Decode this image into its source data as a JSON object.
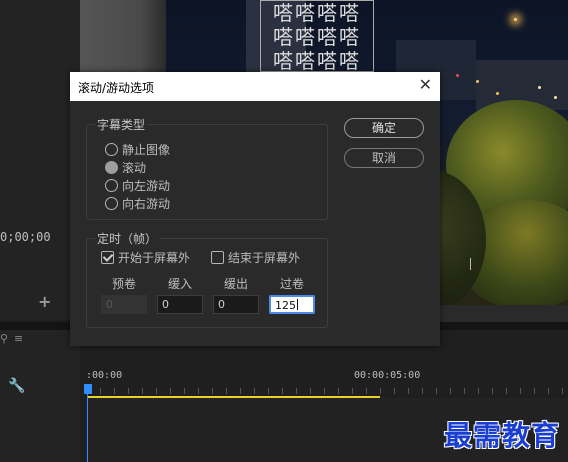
{
  "background": {
    "timecode_left": "0;00;00",
    "add_label": "+",
    "timeline": {
      "start_timecode": ":00:00",
      "end_timecode": "00:00:05:00",
      "playhead_color": "#2f8fff",
      "work_area_color": "#e8d12b"
    },
    "watermark": "最需教育",
    "title_grid_text": "嗒嗒嗒嗒"
  },
  "dialog": {
    "title": "滚动/游动选项",
    "close_label": "✕",
    "subtitle_group": {
      "legend": "字幕类型",
      "options": [
        {
          "label": "静止图像",
          "selected": false
        },
        {
          "label": "滚动",
          "selected": true
        },
        {
          "label": "向左游动",
          "selected": false
        },
        {
          "label": "向右游动",
          "selected": false
        }
      ]
    },
    "timing_group": {
      "legend": "定时（帧）",
      "start_offscreen": {
        "label": "开始于屏幕外",
        "checked": true
      },
      "end_offscreen": {
        "label": "结束于屏幕外",
        "checked": false
      },
      "fields": [
        {
          "label": "预卷",
          "value": "0",
          "state": "disabled"
        },
        {
          "label": "缓入",
          "value": "0",
          "state": "normal"
        },
        {
          "label": "缓出",
          "value": "0",
          "state": "normal"
        },
        {
          "label": "过卷",
          "value": "125",
          "state": "focused"
        }
      ]
    },
    "ok_label": "确定",
    "cancel_label": "取消"
  }
}
